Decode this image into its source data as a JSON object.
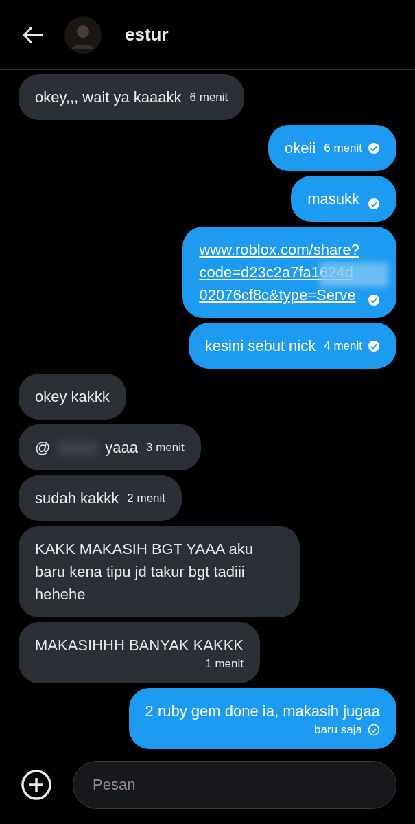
{
  "header": {
    "name": "estur"
  },
  "messages": [
    {
      "kind": "received",
      "text": "okey,,, wait ya kaaakk",
      "time": "6 menit",
      "time_below": false
    },
    {
      "kind": "sent",
      "text": "okeii",
      "time": "6 menit",
      "time_below": false,
      "read": true
    },
    {
      "kind": "sent",
      "text": "masukk",
      "time_below": false,
      "read": true
    },
    {
      "kind": "link",
      "text": "www.roblox.com/share?\ncode=d23c2a7fa1624d\n02076cf8c&type=Serve",
      "time_below": false,
      "read": true
    },
    {
      "kind": "sent",
      "text": "kesini sebut nick",
      "time": "4 menit",
      "time_below": false,
      "read": true
    },
    {
      "kind": "received",
      "text": "okey kakkk",
      "time_below": false
    },
    {
      "kind": "mention",
      "text": "@",
      "text_after": "yaaa",
      "time": "3 menit",
      "time_below": false
    },
    {
      "kind": "received",
      "text": "sudah kakkk",
      "time": "2 menit",
      "time_below": false
    },
    {
      "kind": "received",
      "text": "KAKK MAKASIH BGT YAAA aku baru kena tipu jd takur bgt tadiii hehehe",
      "time_below": false
    },
    {
      "kind": "received",
      "text": "MAKASIHHH BANYAK KAKKK",
      "time": "1 menit",
      "time_below": true
    },
    {
      "kind": "sent",
      "text": "2 ruby gem done ia, makasih jugaa",
      "time": "baru saja",
      "time_below": true,
      "read": false
    }
  ],
  "composer": {
    "placeholder": "Pesan"
  }
}
